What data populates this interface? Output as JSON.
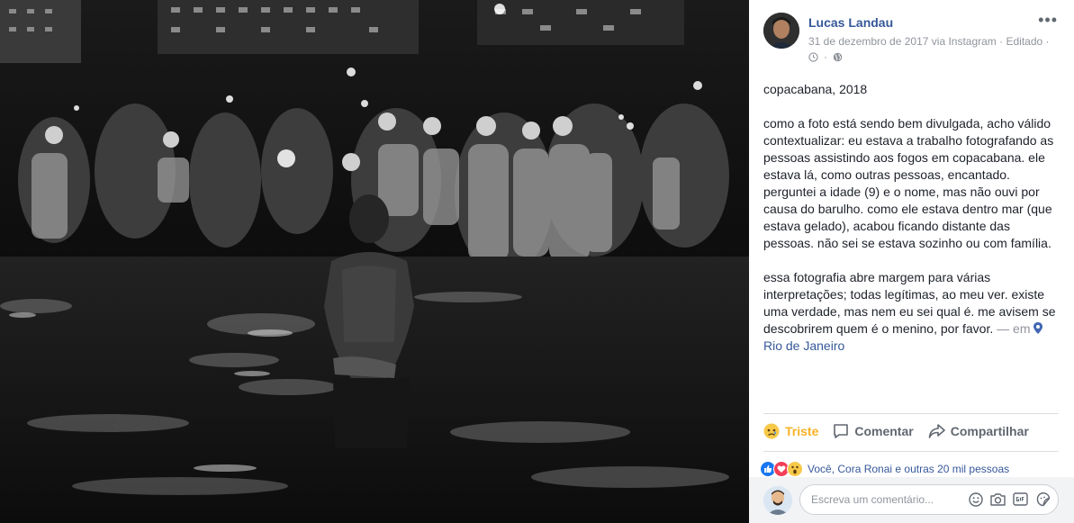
{
  "post": {
    "author": "Lucas Landau",
    "date": "31 de dezembro de 2017",
    "via": " via Instagram",
    "edited": " · Editado ·",
    "more_label": "•••",
    "caption_title": "copacabana, 2018",
    "caption_p1": "como a foto está sendo bem divulgada, acho válido contextualizar: eu estava a trabalho fotografando as pessoas assistindo aos fogos em copacabana. ele estava lá, como outras pessoas, encantado. perguntei a idade (9) e o nome, mas não ouvi por causa do barulho. como ele estava dentro mar (que estava gelado), acabou ficando distante das pessoas. não sei se estava sozinho ou com família.",
    "caption_p2": "essa fotografia abre margem para várias interpretações; todas legítimas, ao meu ver. existe uma verdade, mas nem eu sei qual é. me avisem se descobrirem quem é o menino, por favor.",
    "location_prefix": " — em ",
    "location": "Rio de Janeiro"
  },
  "actions": {
    "react_label": "Triste",
    "comment_label": "Comentar",
    "share_label": "Compartilhar"
  },
  "reactions": {
    "summary": "Você, Cora Ronai e outras 20 mil pessoas"
  },
  "comment": {
    "placeholder": "Escreva um comentário..."
  },
  "icons": [
    "clock-icon",
    "globe-icon",
    "sad-emoji-icon",
    "comment-icon",
    "share-icon",
    "like-reaction-icon",
    "love-reaction-icon",
    "wow-reaction-icon",
    "location-pin-icon",
    "emoji-icon",
    "camera-icon",
    "gif-icon",
    "sticker-icon"
  ],
  "colors": {
    "link": "#365899",
    "sad": "#f7b125",
    "like": "#1877f2",
    "love": "#f33e58",
    "muted": "#90949c"
  }
}
